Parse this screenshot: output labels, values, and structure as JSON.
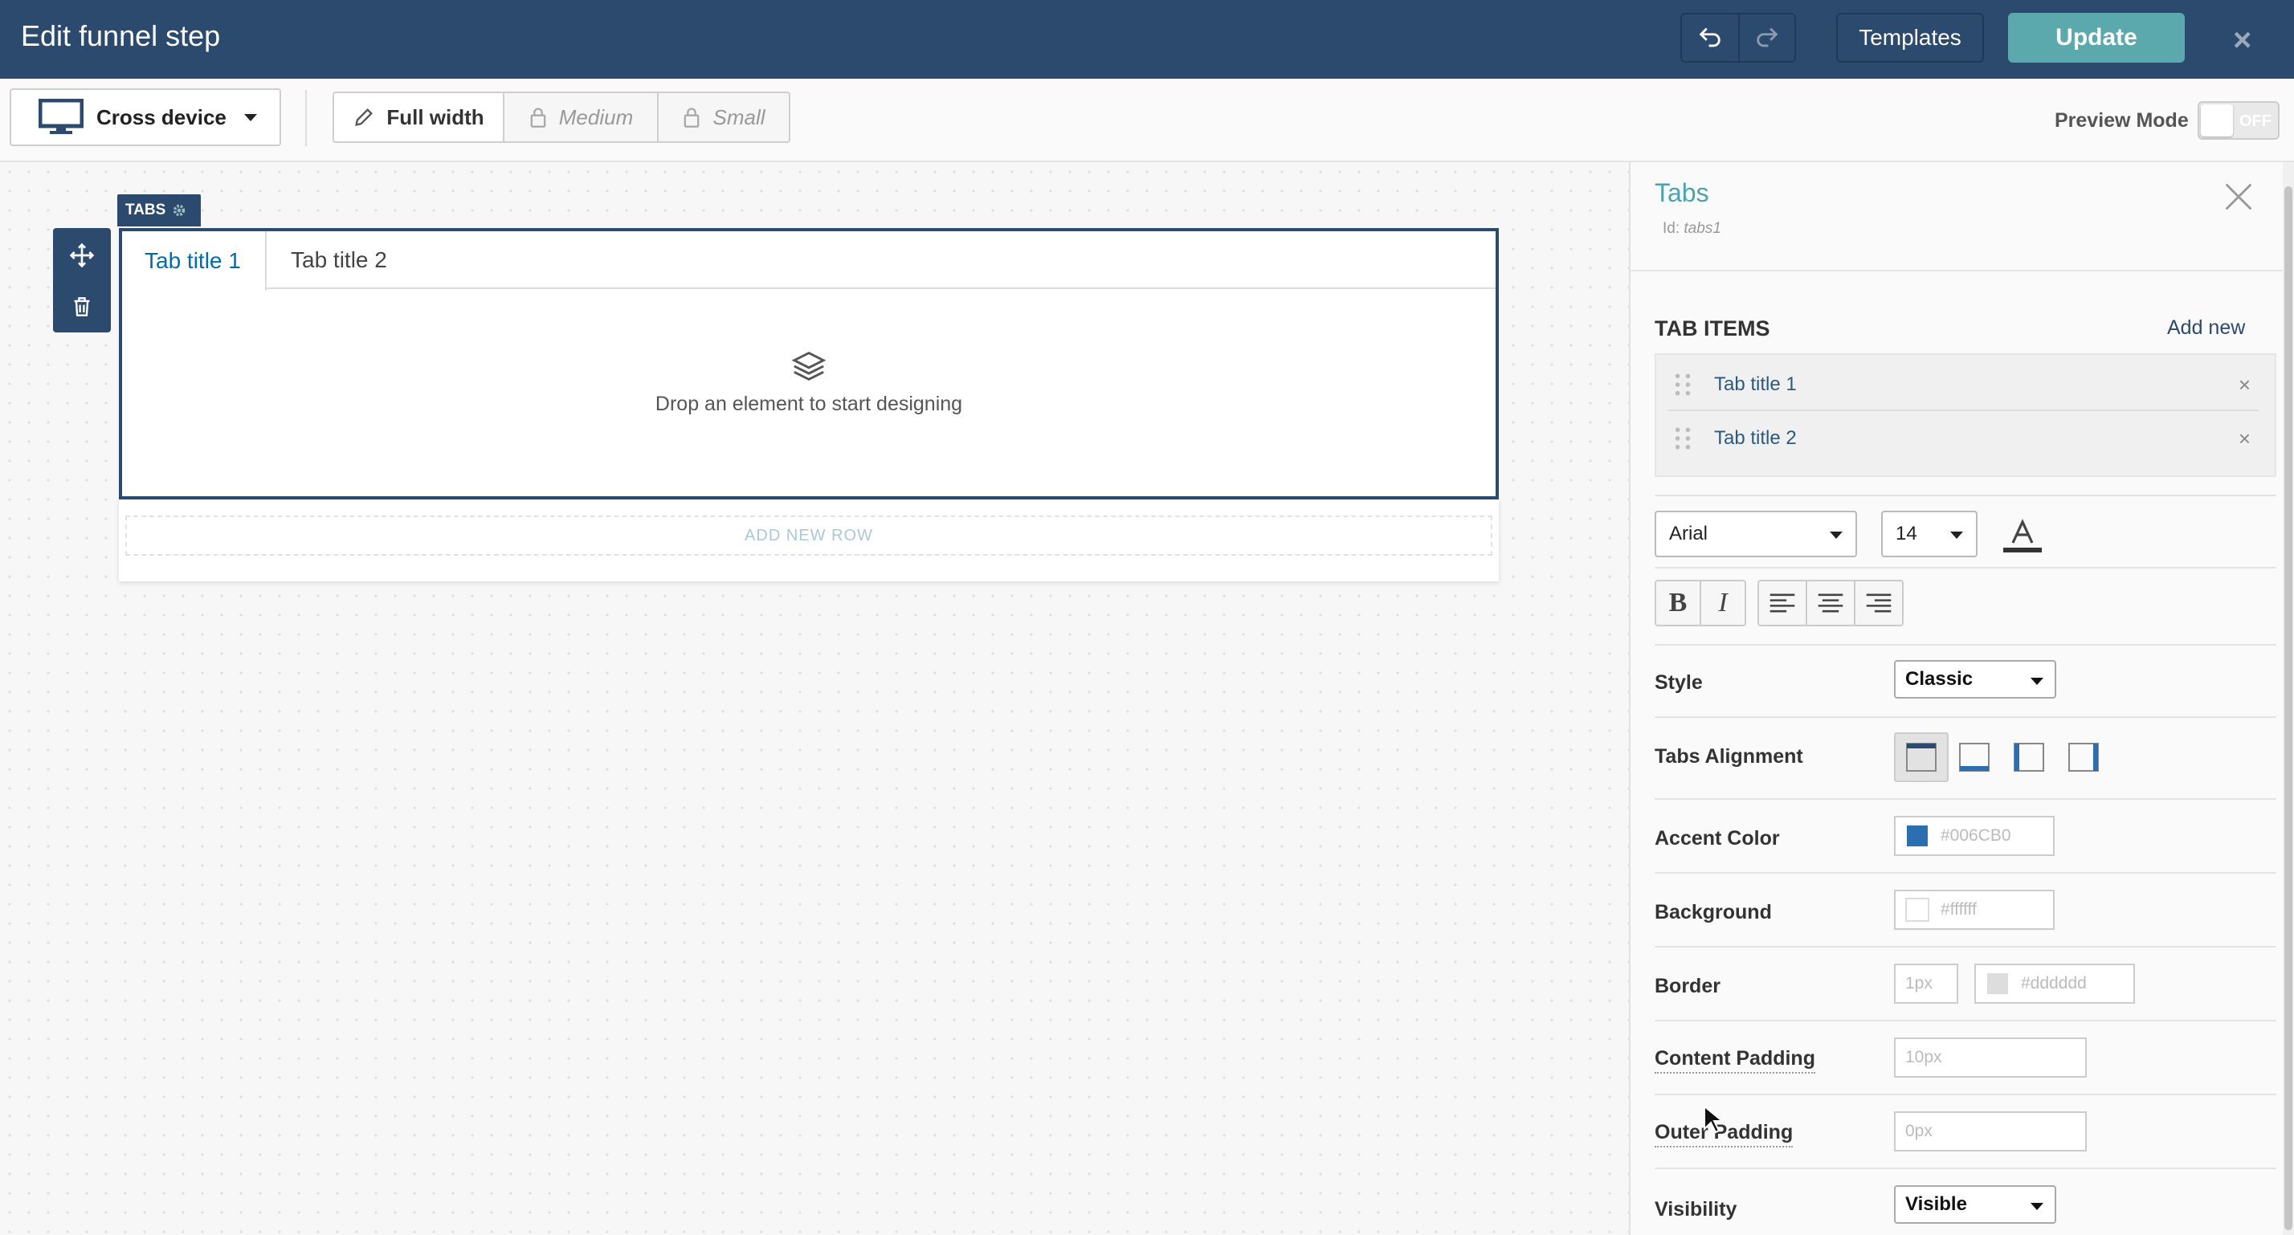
{
  "header": {
    "title": "Edit funnel step",
    "templates_label": "Templates",
    "update_label": "Update",
    "close_glyph": "×"
  },
  "toolbar": {
    "device_label": "Cross device",
    "widths": [
      "Full width",
      "Medium",
      "Small"
    ],
    "preview_label": "Preview Mode",
    "preview_state": "OFF"
  },
  "canvas": {
    "tag_label": "TABS",
    "tabs": [
      "Tab title 1",
      "Tab title 2"
    ],
    "drop_text": "Drop an element to start designing",
    "add_row_label": "ADD NEW ROW"
  },
  "panel": {
    "title": "Tabs",
    "id_label": "Id:",
    "id_value": "tabs1",
    "tab_items_label": "TAB ITEMS",
    "add_new_label": "Add new",
    "items": [
      "Tab title 1",
      "Tab title 2"
    ],
    "remove_glyph": "×",
    "font_family": "Arial",
    "font_size": "14",
    "style_label": "Style",
    "style_value": "Classic",
    "tabs_alignment_label": "Tabs Alignment",
    "accent_color_label": "Accent Color",
    "accent_color_value": "#006CB0",
    "background_label": "Background",
    "background_value": "#ffffff",
    "border_label": "Border",
    "border_width": "1px",
    "border_color": "#dddddd",
    "content_padding_label": "Content Padding",
    "content_padding_value": "10px",
    "outer_padding_label": "Outer Padding",
    "outer_padding_value": "0px",
    "visibility_label": "Visibility",
    "visibility_value": "Visible"
  },
  "colors": {
    "header_bg": "#2b4a6e",
    "update_btn": "#5ba8ad",
    "accent": "#006cb0",
    "panel_title": "#4aa3ad"
  },
  "icons": [
    "undo-icon",
    "redo-icon",
    "monitor-icon",
    "pencil-icon",
    "lock-icon",
    "gear-icon",
    "move-icon",
    "trash-icon",
    "layers-icon",
    "grip-icon",
    "close-icon",
    "font-color-icon",
    "bold-icon",
    "italic-icon",
    "align-left-icon",
    "align-center-icon",
    "align-right-icon"
  ]
}
